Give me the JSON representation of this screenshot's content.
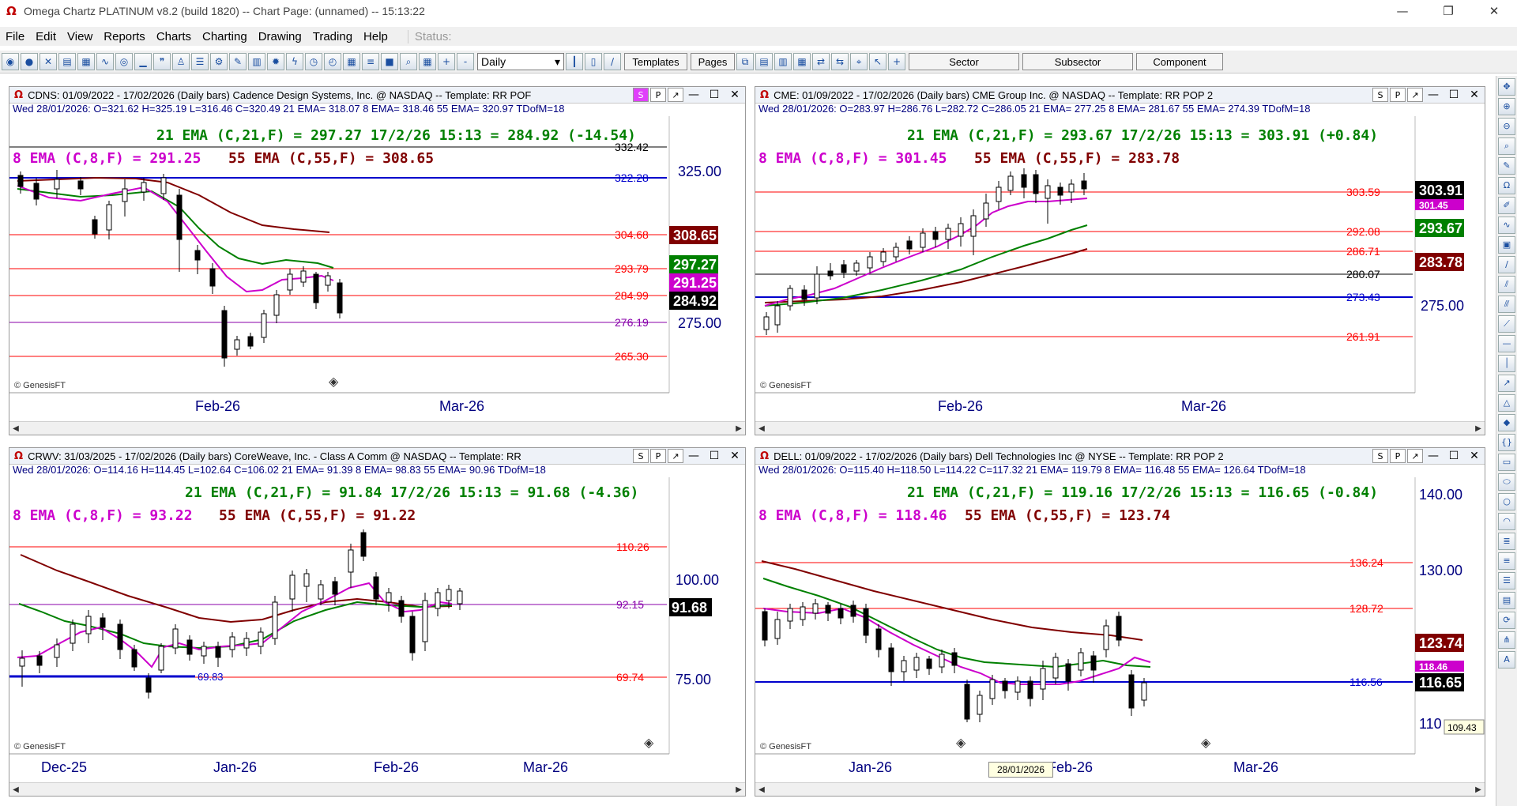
{
  "window": {
    "title": "Omega Chartz PLATINUM v8.2 (build 1820)  --  Chart Page: (unnamed) -- 15:13:22"
  },
  "menu": {
    "items": [
      "File",
      "Edit",
      "View",
      "Reports",
      "Charts",
      "Charting",
      "Drawing",
      "Trading",
      "Help"
    ],
    "status_label": "Status:"
  },
  "toolbar": {
    "interval": "Daily",
    "templates": "Templates",
    "pages": "Pages",
    "sector": "Sector",
    "subsector": "Subsector",
    "component": "Component"
  },
  "colors": {
    "ema8": "#cc00cc",
    "ema21": "#008000",
    "ema55": "#800000",
    "red_line": "#ff0000",
    "blue_line": "#0000cc",
    "purple_line": "#8800aa"
  },
  "panels": [
    {
      "title": "CDNS: 01/09/2022 - 17/02/2026 (Daily bars)   Cadence Design Systems, Inc. @ NASDAQ  --  Template: RR POF",
      "ohlc": "Wed  28/01/2026:  O=321.62  H=325.19  L=316.46  C=320.49  21 EMA= 318.07  8 EMA= 318.46  55 EMA= 320.97  TDofM=18",
      "ema21_line": "21 EMA (C,21,F) = 297.27  17/2/26 15:13 = 284.92 (-14.54)",
      "ema_line2_a": "8 EMA (C,8,F) = 291.25",
      "ema_line2_b": "55 EMA (C,55,F) = 308.65",
      "hlines": [
        "332.42",
        "322.28",
        "304.68",
        "293.79",
        "284.99",
        "276.19",
        "265.30"
      ],
      "axis_labels": [
        "325.00",
        "275.00"
      ],
      "tags": [
        "308.65",
        "297.27",
        "291.25",
        "284.92"
      ],
      "x_labels": [
        "Feb-26",
        "Mar-26"
      ],
      "copyright": "© GenesisFT"
    },
    {
      "title": "CME: 01/09/2022 - 17/02/2026 (Daily bars)   CME Group Inc. @ NASDAQ  --  Template: RR POP 2",
      "ohlc": "Wed  28/01/2026:  O=283.97  H=286.76  L=282.72  C=286.05  21 EMA= 277.25  8 EMA= 281.67  55 EMA= 274.39  TDofM=18",
      "ema21_line": "21 EMA (C,21,F) = 293.67  17/2/26 15:13 = 303.91 (+0.84)",
      "ema_line2_a": "8 EMA (C,8,F) = 301.45",
      "ema_line2_b": "55 EMA (C,55,F) = 283.78",
      "hlines": [
        "303.59",
        "292.08",
        "286.71",
        "280.07",
        "273.43",
        "261.91"
      ],
      "axis_labels": [
        "275.00"
      ],
      "tags": [
        "303.91",
        "301.45",
        "293.67",
        "283.78"
      ],
      "x_labels": [
        "Feb-26",
        "Mar-26"
      ],
      "copyright": "© GenesisFT"
    },
    {
      "title": "CRWV: 31/03/2025 - 17/02/2026 (Daily bars)   CoreWeave, Inc. - Class A Comm @ NASDAQ  --  Template: RR",
      "ohlc": "Wed  28/01/2026:  O=114.16  H=114.45  L=102.64  C=106.02  21 EMA= 91.39  8 EMA= 98.83  55 EMA= 90.96  TDofM=18",
      "ema21_line": "21 EMA (C,21,F) = 91.84  17/2/26 15:13 = 91.68 (-4.36)",
      "ema_line2_a": "8 EMA (C,8,F) = 93.22",
      "ema_line2_b": "55 EMA (C,55,F) = 91.22",
      "hlines": [
        "110.26",
        "92.15",
        "69.74"
      ],
      "hline_blue": "69.83",
      "axis_labels": [
        "100.00",
        "75.00"
      ],
      "tags": [
        "91.68"
      ],
      "x_labels": [
        "Dec-25",
        "Jan-26",
        "Feb-26",
        "Mar-26"
      ],
      "copyright": "© GenesisFT"
    },
    {
      "title": "DELL: 01/09/2022 - 17/02/2026 (Daily bars)   Dell Technologies Inc @ NYSE  --  Template: RR POP 2",
      "ohlc": "Wed  28/01/2026:  O=115.40  H=118.50  L=114.22  C=117.32  21 EMA= 119.79  8 EMA= 116.48  55 EMA= 126.64  TDofM=18",
      "ema21_line": "21 EMA (C,21,F) = 119.16  17/2/26 15:13 = 116.65 (-0.84)",
      "ema_line2_a": "8 EMA (C,8,F) = 118.46",
      "ema_line2_b": "55 EMA (C,55,F) = 123.74",
      "hlines": [
        "136.24",
        "128.72",
        "116.56"
      ],
      "axis_labels": [
        "140.00",
        "130.00",
        "110"
      ],
      "tags": [
        "123.74",
        "118.46",
        "116.65"
      ],
      "side_tag": "109.43",
      "x_labels": [
        "Jan-26",
        "Feb-26",
        "Mar-26"
      ],
      "copyright": "© GenesisFT",
      "cursor_date": "28/01/2026"
    }
  ]
}
